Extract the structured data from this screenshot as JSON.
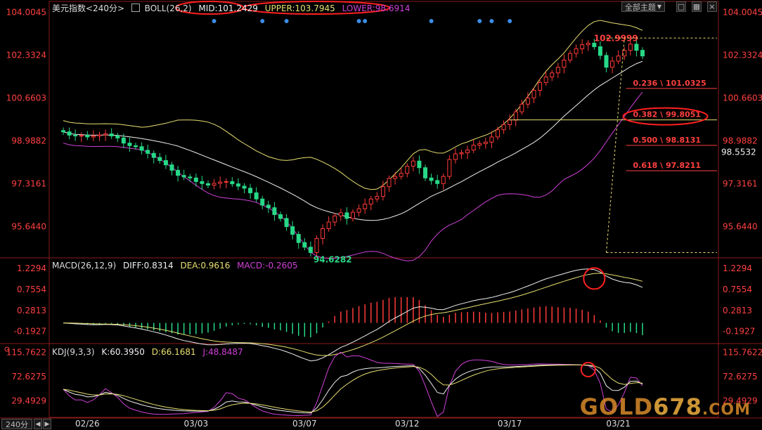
{
  "header": {
    "symbol": "美元指数<240分>",
    "boll_name": "BOLL(26,2)",
    "mid": "MID:101.2429",
    "upper": "UPPER:103.7945",
    "lower": "LOWER:98.6914"
  },
  "toolbar": {
    "theme_button": "全部主题",
    "dropdown_arrow": "▼"
  },
  "macd_header": {
    "name": "MACD(26,12,9)",
    "diff": "DIFF:0.8314",
    "dea": "DEA:0.9616",
    "macd": "MACD:-0.2605"
  },
  "kdj_header": {
    "name": "KDJ(9,3,3)",
    "k": "K:60.3950",
    "d": "D:66.1681",
    "j": "J:48.8487"
  },
  "footer": {
    "period": "240分"
  },
  "watermark": {
    "prefix": "GOLD",
    "digits": "678",
    "suffix": ".COM"
  },
  "colors": {
    "up": "#ff3a3a",
    "down": "#27d987",
    "boll_mid": "#f0f0f0",
    "boll_upper": "#e8e070",
    "boll_lower": "#d040d8",
    "diff": "#f0f0f0",
    "dea": "#e8e070",
    "macd_label": "#d040d8",
    "k_line": "#f0f0f0",
    "d_line": "#e8e070",
    "j_line": "#d040d8",
    "fib": "#ff4040",
    "annotation_circle": "#ff2020",
    "signal_dot": "#3a8ee8"
  },
  "chart_data": [
    {
      "type": "candlestick",
      "title": "美元指数<240分>",
      "y_ticks": [
        "104.0045",
        "102.3324",
        "100.6603",
        "98.9882",
        "97.3161",
        "95.6440"
      ],
      "ylim": [
        94.45,
        104.1
      ],
      "x_labels": [
        "02/26",
        "03/03",
        "03/07",
        "03/12",
        "03/17",
        "03/21"
      ],
      "x_label_index": [
        4,
        22,
        40,
        57,
        74,
        92
      ],
      "n": 97,
      "close": [
        99.34,
        99.21,
        99.18,
        99.2,
        99.14,
        99.18,
        99.22,
        99.26,
        99.18,
        99.1,
        98.9,
        98.8,
        98.76,
        98.62,
        98.5,
        98.34,
        98.22,
        98.05,
        97.84,
        97.64,
        97.58,
        97.54,
        97.4,
        97.32,
        97.26,
        97.33,
        97.38,
        97.4,
        97.31,
        97.22,
        97.14,
        96.96,
        96.72,
        96.48,
        96.38,
        96.11,
        95.96,
        95.64,
        95.34,
        95.02,
        94.84,
        94.63,
        95.18,
        95.56,
        95.82,
        96.06,
        96.18,
        95.96,
        96.2,
        96.34,
        96.52,
        96.72,
        96.82,
        97.2,
        97.52,
        97.6,
        97.72,
        98.0,
        98.2,
        97.94,
        97.54,
        97.44,
        97.32,
        97.6,
        98.26,
        98.48,
        98.52,
        98.63,
        98.82,
        98.88,
        98.94,
        99.14,
        99.42,
        99.62,
        99.8,
        100.12,
        100.42,
        100.66,
        100.96,
        101.26,
        101.48,
        101.64,
        101.86,
        102.14,
        102.4,
        102.58,
        102.74,
        102.8,
        102.66,
        102.32,
        101.86,
        102.1,
        102.3,
        102.52,
        102.76,
        102.52,
        102.3
      ],
      "last_price": "98.5532",
      "extremes": {
        "high": "102.9999",
        "low": "94.6282"
      },
      "fib_levels": [
        {
          "label": "0.236 \\ 101.0325",
          "value": 101.0325
        },
        {
          "label": "0.382 \\ 99.8051",
          "value": 99.8051
        },
        {
          "label": "0.500 \\ 98.8131",
          "value": 98.8131
        },
        {
          "label": "0.618 \\ 97.8211",
          "value": 97.8211
        }
      ],
      "boll": {
        "upper": 103.7945,
        "mid": 101.2429,
        "lower": 98.6914
      },
      "signal_dot_index": [
        25,
        33,
        37,
        49,
        50,
        61,
        69,
        71,
        74
      ]
    },
    {
      "type": "line",
      "title": "MACD(26,12,9)",
      "y_ticks": [
        "1.2294",
        "0.7554",
        "0.2813",
        "-0.1927"
      ],
      "ylim": [
        -0.45,
        1.45
      ],
      "series": [
        {
          "name": "DIFF"
        },
        {
          "name": "DEA"
        },
        {
          "name": "MACD"
        }
      ],
      "last": {
        "diff": 0.8314,
        "dea": 0.9616,
        "macd": -0.2605
      }
    },
    {
      "type": "line",
      "title": "KDJ(9,3,3)",
      "y_ticks": [
        "115.7622",
        "72.6275",
        "29.4929"
      ],
      "ylim": [
        0,
        130
      ],
      "series": [
        {
          "name": "K"
        },
        {
          "name": "D"
        },
        {
          "name": "J"
        }
      ],
      "last": {
        "k": 60.395,
        "d": 66.1681,
        "j": 48.8487
      }
    }
  ]
}
